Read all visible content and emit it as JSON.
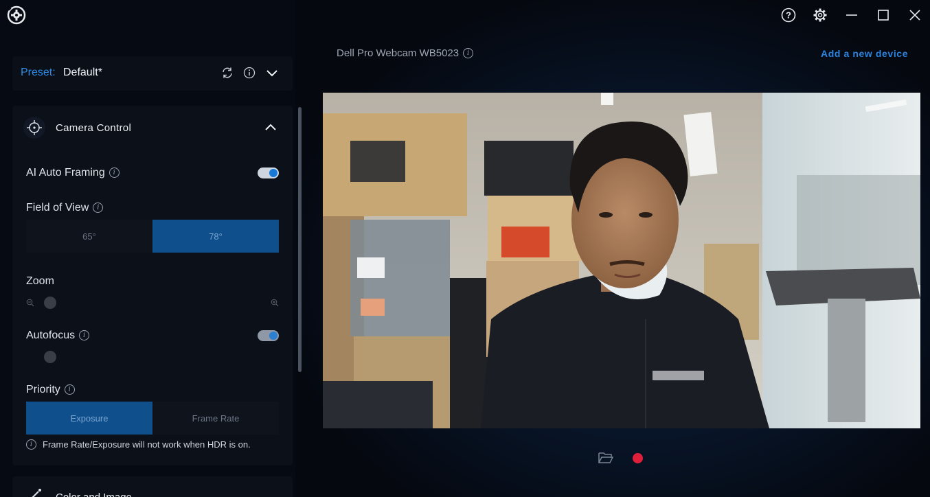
{
  "window": {
    "help_icon": "question-circle-icon",
    "settings_icon": "gear-icon",
    "minimize_icon": "minimize-icon",
    "maximize_icon": "maximize-icon",
    "close_icon": "close-icon"
  },
  "preset": {
    "label": "Preset:",
    "value": "Default*"
  },
  "camera_control": {
    "title": "Camera Control",
    "ai_auto_framing": {
      "label": "AI Auto Framing",
      "enabled": true
    },
    "field_of_view": {
      "label": "Field of View",
      "options": [
        "65°",
        "78°"
      ],
      "selected": "78°"
    },
    "zoom": {
      "label": "Zoom"
    },
    "autofocus": {
      "label": "Autofocus",
      "enabled": true
    },
    "priority": {
      "label": "Priority",
      "options": [
        "Exposure",
        "Frame Rate"
      ],
      "selected": "Exposure"
    },
    "note": "Frame Rate/Exposure will not work when HDR is on."
  },
  "color_image": {
    "title": "Color and Image"
  },
  "device": {
    "name": "Dell Pro Webcam WB5023",
    "add_label": "Add a new device"
  },
  "colors": {
    "accent": "#1679d8",
    "record": "#e0203a"
  }
}
